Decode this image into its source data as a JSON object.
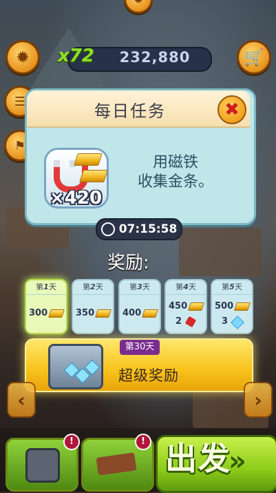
{
  "hud": {
    "multiplier": "x72",
    "score": "232,880"
  },
  "popup": {
    "title": "每日任务",
    "task": {
      "count": "×420",
      "description_line1": "用磁铁",
      "description_line2": "收集金条。"
    },
    "timer": "07:15:58"
  },
  "rewards": {
    "label": "奖励:",
    "days": [
      {
        "prefix": "第",
        "num": "1",
        "suffix": "天",
        "coins": "300",
        "extra": "",
        "extra_icon": ""
      },
      {
        "prefix": "第",
        "num": "2",
        "suffix": "天",
        "coins": "350",
        "extra": "",
        "extra_icon": ""
      },
      {
        "prefix": "第",
        "num": "3",
        "suffix": "天",
        "coins": "400",
        "extra": "",
        "extra_icon": ""
      },
      {
        "prefix": "第",
        "num": "4",
        "suffix": "天",
        "coins": "450",
        "extra": "2",
        "extra_icon": "dynamite-icon"
      },
      {
        "prefix": "第",
        "num": "5",
        "suffix": "天",
        "coins": "500",
        "extra": "3",
        "extra_icon": "gem-icon"
      }
    ],
    "super": {
      "badge": "第30天",
      "label": "超级奖励"
    }
  },
  "bottom": {
    "go_label": "出发",
    "go_arrows": "»",
    "badge": "!"
  },
  "colors": {
    "popup_bg": "#bfe7ea",
    "active_day": "#e9f9b9",
    "super_gold": "#f7c21b",
    "go_green": "#8ccc1a"
  }
}
